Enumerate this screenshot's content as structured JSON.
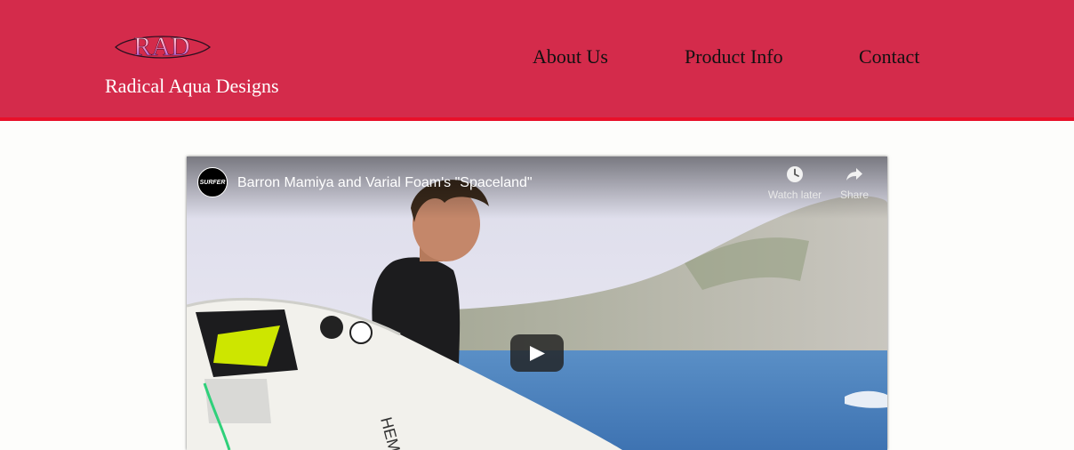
{
  "header": {
    "logo_text": "RAD",
    "site_name": "Radical Aqua Designs",
    "background_color": "#d42b4b",
    "border_color": "#e8102a"
  },
  "nav": {
    "items": [
      {
        "label": "About Us"
      },
      {
        "label": "Product Info"
      },
      {
        "label": "Contact"
      }
    ]
  },
  "video": {
    "title": "Barron Mamiya and Varial Foam's \"Spaceland\"",
    "channel": "SURFER",
    "watch_later_label": "Watch later",
    "share_label": "Share",
    "icons": [
      "clock-icon",
      "share-arrow-icon",
      "play-icon"
    ]
  }
}
